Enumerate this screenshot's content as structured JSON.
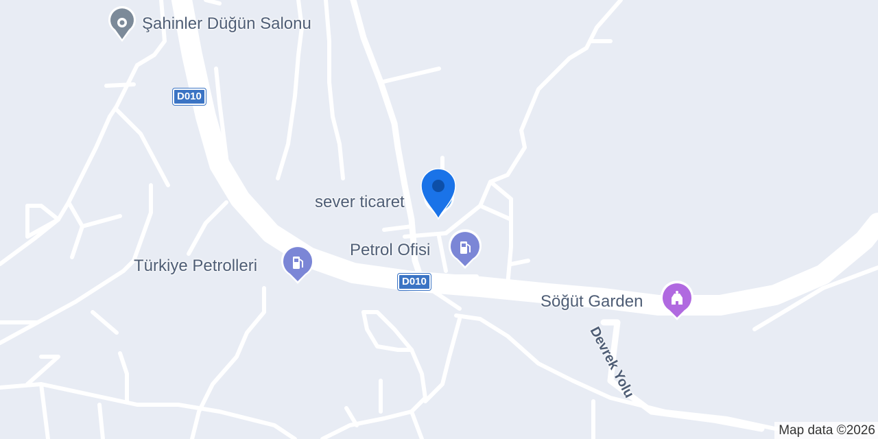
{
  "map": {
    "background": "#e8ecf4",
    "road_color": "#ffffff"
  },
  "places": [
    {
      "name": "Şahinler Düğün Salonu",
      "icon": "place-pin-icon",
      "color": "#7c8a99"
    },
    {
      "name": "sever ticaret",
      "icon": "selected-location-pin-icon",
      "color": "#1a73e8"
    },
    {
      "name": "Petrol Ofisi",
      "icon": "gas-station-icon",
      "color": "#7b86d6"
    },
    {
      "name": "Türkiye Petrolleri",
      "icon": "gas-station-icon",
      "color": "#7b86d6"
    },
    {
      "name": "Söğüt Garden",
      "icon": "event-venue-icon",
      "color": "#b069e0"
    }
  ],
  "road_shields": [
    "D010",
    "D010"
  ],
  "street_names": [
    "Devrek Yolu"
  ],
  "attribution": "Map data ©2026"
}
